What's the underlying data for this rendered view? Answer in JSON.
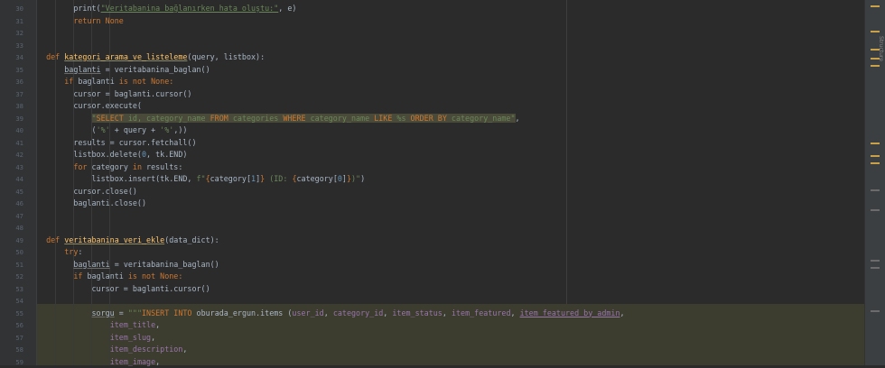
{
  "gutter": {
    "line_numbers": [
      "30",
      "31",
      "32",
      "33",
      "34",
      "35",
      "36",
      "37",
      "38",
      "39",
      "40",
      "41",
      "42",
      "43",
      "44",
      "45",
      "46",
      "47",
      "48",
      "49",
      "50",
      "51",
      "52",
      "53",
      "54",
      "55",
      "56",
      "57",
      "58",
      "59"
    ]
  },
  "code": {
    "l30": {
      "a": "print(",
      "b": "\"Veritabanina bağlanırken hata oluştu:\"",
      "c": ", e)"
    },
    "l31": {
      "kw": "return",
      "b": " None"
    },
    "l34": {
      "kw": "def ",
      "fn": "kategori_arama_ve_listeleme",
      "rest": "(query, listbox):"
    },
    "l35": {
      "var": "baglanti",
      "rest": " = veritabanina_baglan()"
    },
    "l36": {
      "kw": "if",
      "a": " baglanti ",
      "kw2": "is not",
      "b": " None:"
    },
    "l37": {
      "a": "cursor = baglanti.cursor()"
    },
    "l38": {
      "a": "cursor.execute("
    },
    "l39": {
      "q": "\"",
      "s1": "SELECT",
      "t1": " id, category_name ",
      "s2": "FROM",
      "t2": " categories ",
      "s3": "WHERE",
      "t3": " category_name ",
      "s4": "LIKE",
      "t4": " %s ",
      "s5": "ORDER BY",
      "t5": " category_name",
      "q2": "\"",
      "end": ","
    },
    "l40": {
      "a": "(",
      "s": "'%'",
      "b": " + query + ",
      "s2": "'%'",
      "c": ",))"
    },
    "l41": {
      "a": "results = cursor.fetchall()"
    },
    "l42": {
      "a": "listbox.delete(",
      "n": "0",
      "b": ", tk.END)"
    },
    "l43": {
      "kw": "for",
      "a": " category ",
      "kw2": "in",
      "b": " results:"
    },
    "l44": {
      "a": "listbox.insert(tk.END, ",
      "f": "f\"",
      "b1": "{",
      "v1": "category[",
      "n1": "1",
      "v2": "]",
      "b2": "}",
      "m": " (ID: ",
      "b3": "{",
      "v3": "category[",
      "n2": "0",
      "v4": "]",
      "b4": "}",
      "e": ")\"",
      "end": ")"
    },
    "l45": {
      "a": "cursor.close()"
    },
    "l46": {
      "a": "baglanti.close()"
    },
    "l49": {
      "kw": "def ",
      "fn": "veritabanina_veri_ekle",
      "rest": "(data_dict):"
    },
    "l50": {
      "kw": "try",
      "rest": ":"
    },
    "l51": {
      "var": "baglanti",
      "rest": " = veritabanina_baglan()"
    },
    "l52": {
      "kw": "if",
      "a": " baglanti ",
      "kw2": "is not",
      "b": " None:"
    },
    "l53": {
      "a": "cursor = baglanti.cursor()"
    },
    "l55": {
      "var": "sorgu",
      "a": " = ",
      "q": "\"\"\"",
      "s1": "INSERT INTO",
      "t1": " oburada_ergun.items (",
      "f1": "user_id",
      "c1": ", ",
      "f2": "category_id",
      "c2": ", ",
      "f3": "item_status",
      "c3": ", ",
      "f4": "item_featured",
      "c4": ", ",
      "f5": "item_featured_by_admin",
      "end": ","
    },
    "l56": {
      "f": "item_title",
      "end": ","
    },
    "l57": {
      "f": "item_slug",
      "end": ","
    },
    "l58": {
      "f": "item_description",
      "end": ","
    },
    "l59": {
      "f": "item_image",
      "end": ","
    }
  },
  "side_panel": {
    "tab_label": "Structure"
  }
}
